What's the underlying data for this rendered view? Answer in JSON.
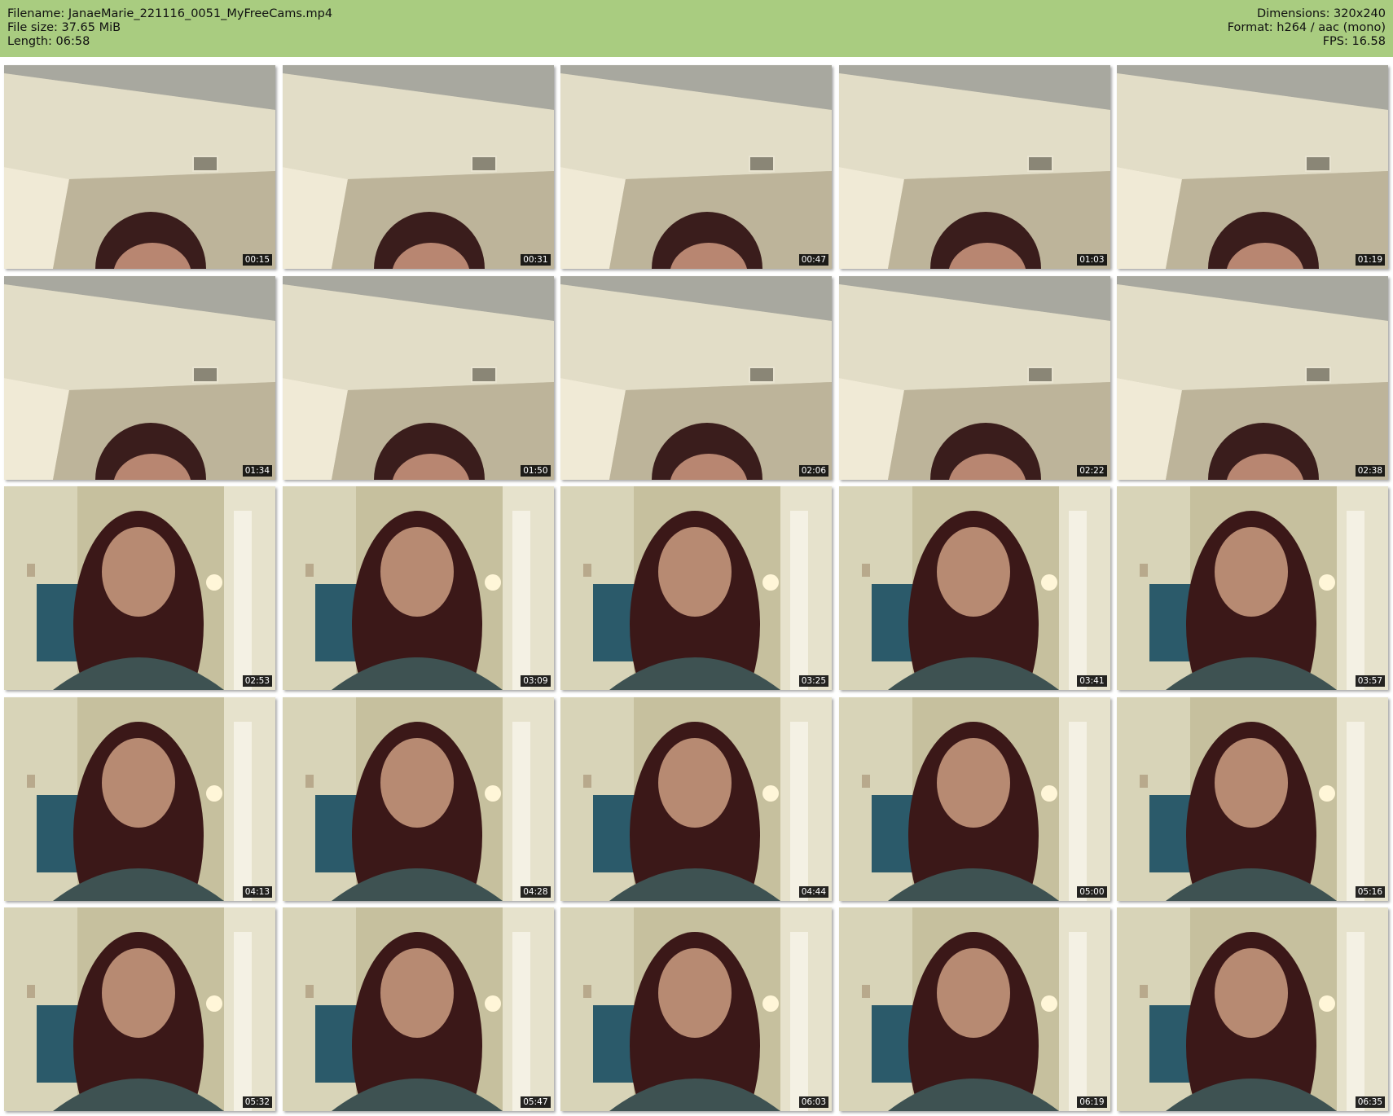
{
  "header": {
    "filename": "Filename: JanaeMarie_221116_0051_MyFreeCams.mp4",
    "file_size": "File size: 37.65 MiB",
    "length": "Length: 06:58",
    "dimensions": "Dimensions: 320x240",
    "format": "Format: h264 / aac (mono)",
    "fps": "FPS: 16.58",
    "bg_color": "#a9cc80"
  },
  "thumbnails": [
    {
      "time": "00:15",
      "scene": "ceiling"
    },
    {
      "time": "00:31",
      "scene": "ceiling"
    },
    {
      "time": "00:47",
      "scene": "ceiling"
    },
    {
      "time": "01:03",
      "scene": "ceiling"
    },
    {
      "time": "01:19",
      "scene": "ceiling"
    },
    {
      "time": "01:34",
      "scene": "ceiling"
    },
    {
      "time": "01:50",
      "scene": "ceiling"
    },
    {
      "time": "02:06",
      "scene": "ceiling"
    },
    {
      "time": "02:22",
      "scene": "ceiling"
    },
    {
      "time": "02:38",
      "scene": "ceiling"
    },
    {
      "time": "02:53",
      "scene": "room"
    },
    {
      "time": "03:09",
      "scene": "room"
    },
    {
      "time": "03:25",
      "scene": "room"
    },
    {
      "time": "03:41",
      "scene": "room"
    },
    {
      "time": "03:57",
      "scene": "room"
    },
    {
      "time": "04:13",
      "scene": "room"
    },
    {
      "time": "04:28",
      "scene": "room"
    },
    {
      "time": "04:44",
      "scene": "room"
    },
    {
      "time": "05:00",
      "scene": "room"
    },
    {
      "time": "05:16",
      "scene": "room"
    },
    {
      "time": "05:32",
      "scene": "room"
    },
    {
      "time": "05:47",
      "scene": "room"
    },
    {
      "time": "06:03",
      "scene": "room"
    },
    {
      "time": "06:19",
      "scene": "room"
    },
    {
      "time": "06:35",
      "scene": "room"
    }
  ]
}
